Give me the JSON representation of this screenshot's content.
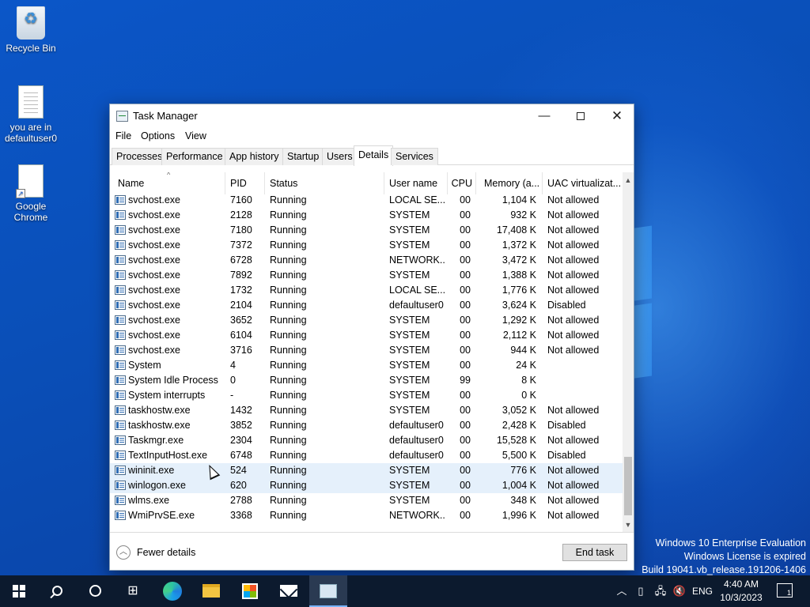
{
  "desktop": {
    "icons": [
      {
        "label": "Recycle Bin",
        "icon": "recycle-bin-icon"
      },
      {
        "label": "you are in defaultuser0",
        "icon": "text-document-icon"
      },
      {
        "label": "Google Chrome",
        "icon": "shortcut-document-icon"
      }
    ],
    "watermark": {
      "line1": "Windows 10 Enterprise Evaluation",
      "line2": "Windows License is expired",
      "line3": "Build 19041.vb_release.191206-1406"
    }
  },
  "window": {
    "title": "Task Manager",
    "menu": [
      "File",
      "Options",
      "View"
    ],
    "tabs": [
      "Processes",
      "Performance",
      "App history",
      "Startup",
      "Users",
      "Details",
      "Services"
    ],
    "active_tab": "Details",
    "columns": [
      "Name",
      "PID",
      "Status",
      "User name",
      "CPU",
      "Memory (a...",
      "UAC virtualizat..."
    ],
    "rows": [
      {
        "name": "svchost.exe",
        "pid": "7160",
        "status": "Running",
        "user": "LOCAL SE...",
        "cpu": "00",
        "mem": "1,104 K",
        "uac": "Not allowed"
      },
      {
        "name": "svchost.exe",
        "pid": "2128",
        "status": "Running",
        "user": "SYSTEM",
        "cpu": "00",
        "mem": "932 K",
        "uac": "Not allowed"
      },
      {
        "name": "svchost.exe",
        "pid": "7180",
        "status": "Running",
        "user": "SYSTEM",
        "cpu": "00",
        "mem": "17,408 K",
        "uac": "Not allowed"
      },
      {
        "name": "svchost.exe",
        "pid": "7372",
        "status": "Running",
        "user": "SYSTEM",
        "cpu": "00",
        "mem": "1,372 K",
        "uac": "Not allowed"
      },
      {
        "name": "svchost.exe",
        "pid": "6728",
        "status": "Running",
        "user": "NETWORK...",
        "cpu": "00",
        "mem": "3,472 K",
        "uac": "Not allowed"
      },
      {
        "name": "svchost.exe",
        "pid": "7892",
        "status": "Running",
        "user": "SYSTEM",
        "cpu": "00",
        "mem": "1,388 K",
        "uac": "Not allowed"
      },
      {
        "name": "svchost.exe",
        "pid": "1732",
        "status": "Running",
        "user": "LOCAL SE...",
        "cpu": "00",
        "mem": "1,776 K",
        "uac": "Not allowed"
      },
      {
        "name": "svchost.exe",
        "pid": "2104",
        "status": "Running",
        "user": "defaultuser0",
        "cpu": "00",
        "mem": "3,624 K",
        "uac": "Disabled"
      },
      {
        "name": "svchost.exe",
        "pid": "3652",
        "status": "Running",
        "user": "SYSTEM",
        "cpu": "00",
        "mem": "1,292 K",
        "uac": "Not allowed"
      },
      {
        "name": "svchost.exe",
        "pid": "6104",
        "status": "Running",
        "user": "SYSTEM",
        "cpu": "00",
        "mem": "2,112 K",
        "uac": "Not allowed"
      },
      {
        "name": "svchost.exe",
        "pid": "3716",
        "status": "Running",
        "user": "SYSTEM",
        "cpu": "00",
        "mem": "944 K",
        "uac": "Not allowed"
      },
      {
        "name": "System",
        "pid": "4",
        "status": "Running",
        "user": "SYSTEM",
        "cpu": "00",
        "mem": "24 K",
        "uac": ""
      },
      {
        "name": "System Idle Process",
        "pid": "0",
        "status": "Running",
        "user": "SYSTEM",
        "cpu": "99",
        "mem": "8 K",
        "uac": ""
      },
      {
        "name": "System interrupts",
        "pid": "-",
        "status": "Running",
        "user": "SYSTEM",
        "cpu": "00",
        "mem": "0 K",
        "uac": ""
      },
      {
        "name": "taskhostw.exe",
        "pid": "1432",
        "status": "Running",
        "user": "SYSTEM",
        "cpu": "00",
        "mem": "3,052 K",
        "uac": "Not allowed"
      },
      {
        "name": "taskhostw.exe",
        "pid": "3852",
        "status": "Running",
        "user": "defaultuser0",
        "cpu": "00",
        "mem": "2,428 K",
        "uac": "Disabled"
      },
      {
        "name": "Taskmgr.exe",
        "pid": "2304",
        "status": "Running",
        "user": "defaultuser0",
        "cpu": "00",
        "mem": "15,528 K",
        "uac": "Not allowed"
      },
      {
        "name": "TextInputHost.exe",
        "pid": "6748",
        "status": "Running",
        "user": "defaultuser0",
        "cpu": "00",
        "mem": "5,500 K",
        "uac": "Disabled"
      },
      {
        "name": "wininit.exe",
        "pid": "524",
        "status": "Running",
        "user": "SYSTEM",
        "cpu": "00",
        "mem": "776 K",
        "uac": "Not allowed"
      },
      {
        "name": "winlogon.exe",
        "pid": "620",
        "status": "Running",
        "user": "SYSTEM",
        "cpu": "00",
        "mem": "1,004 K",
        "uac": "Not allowed"
      },
      {
        "name": "wlms.exe",
        "pid": "2788",
        "status": "Running",
        "user": "SYSTEM",
        "cpu": "00",
        "mem": "348 K",
        "uac": "Not allowed"
      },
      {
        "name": "WmiPrvSE.exe",
        "pid": "3368",
        "status": "Running",
        "user": "NETWORK...",
        "cpu": "00",
        "mem": "1,996 K",
        "uac": "Not allowed"
      }
    ],
    "highlighted_rows": [
      "wininit.exe",
      "winlogon.exe"
    ],
    "footer": {
      "fewer_details": "Fewer details",
      "end_task": "End task"
    }
  },
  "taskbar": {
    "apps": [
      "start-icon",
      "search-icon",
      "cortana-icon",
      "task-view-icon",
      "edge-icon",
      "file-explorer-icon",
      "store-icon",
      "mail-icon",
      "task-manager-icon"
    ],
    "tray": {
      "language": "ENG",
      "time": "4:40 AM",
      "date": "10/3/2023",
      "notifications": "1"
    }
  },
  "colors": {
    "accent": "#0a4fb8",
    "highlight_row": "#e5f0fb",
    "taskbar": "#0c1a2e"
  }
}
